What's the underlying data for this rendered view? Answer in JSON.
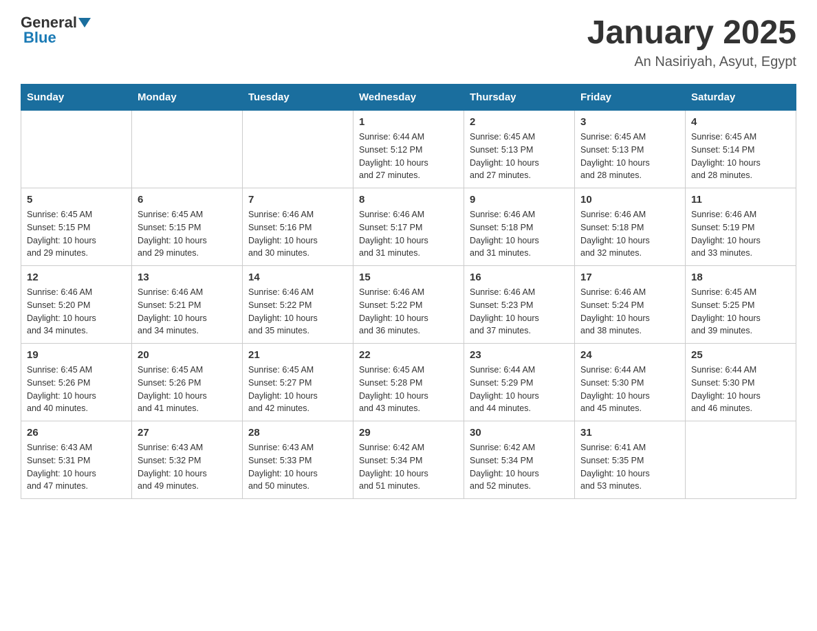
{
  "header": {
    "logo_general": "General",
    "logo_blue": "Blue",
    "title": "January 2025",
    "subtitle": "An Nasiriyah, Asyut, Egypt"
  },
  "calendar": {
    "days_of_week": [
      "Sunday",
      "Monday",
      "Tuesday",
      "Wednesday",
      "Thursday",
      "Friday",
      "Saturday"
    ],
    "weeks": [
      [
        {
          "day": "",
          "info": ""
        },
        {
          "day": "",
          "info": ""
        },
        {
          "day": "",
          "info": ""
        },
        {
          "day": "1",
          "info": "Sunrise: 6:44 AM\nSunset: 5:12 PM\nDaylight: 10 hours\nand 27 minutes."
        },
        {
          "day": "2",
          "info": "Sunrise: 6:45 AM\nSunset: 5:13 PM\nDaylight: 10 hours\nand 27 minutes."
        },
        {
          "day": "3",
          "info": "Sunrise: 6:45 AM\nSunset: 5:13 PM\nDaylight: 10 hours\nand 28 minutes."
        },
        {
          "day": "4",
          "info": "Sunrise: 6:45 AM\nSunset: 5:14 PM\nDaylight: 10 hours\nand 28 minutes."
        }
      ],
      [
        {
          "day": "5",
          "info": "Sunrise: 6:45 AM\nSunset: 5:15 PM\nDaylight: 10 hours\nand 29 minutes."
        },
        {
          "day": "6",
          "info": "Sunrise: 6:45 AM\nSunset: 5:15 PM\nDaylight: 10 hours\nand 29 minutes."
        },
        {
          "day": "7",
          "info": "Sunrise: 6:46 AM\nSunset: 5:16 PM\nDaylight: 10 hours\nand 30 minutes."
        },
        {
          "day": "8",
          "info": "Sunrise: 6:46 AM\nSunset: 5:17 PM\nDaylight: 10 hours\nand 31 minutes."
        },
        {
          "day": "9",
          "info": "Sunrise: 6:46 AM\nSunset: 5:18 PM\nDaylight: 10 hours\nand 31 minutes."
        },
        {
          "day": "10",
          "info": "Sunrise: 6:46 AM\nSunset: 5:18 PM\nDaylight: 10 hours\nand 32 minutes."
        },
        {
          "day": "11",
          "info": "Sunrise: 6:46 AM\nSunset: 5:19 PM\nDaylight: 10 hours\nand 33 minutes."
        }
      ],
      [
        {
          "day": "12",
          "info": "Sunrise: 6:46 AM\nSunset: 5:20 PM\nDaylight: 10 hours\nand 34 minutes."
        },
        {
          "day": "13",
          "info": "Sunrise: 6:46 AM\nSunset: 5:21 PM\nDaylight: 10 hours\nand 34 minutes."
        },
        {
          "day": "14",
          "info": "Sunrise: 6:46 AM\nSunset: 5:22 PM\nDaylight: 10 hours\nand 35 minutes."
        },
        {
          "day": "15",
          "info": "Sunrise: 6:46 AM\nSunset: 5:22 PM\nDaylight: 10 hours\nand 36 minutes."
        },
        {
          "day": "16",
          "info": "Sunrise: 6:46 AM\nSunset: 5:23 PM\nDaylight: 10 hours\nand 37 minutes."
        },
        {
          "day": "17",
          "info": "Sunrise: 6:46 AM\nSunset: 5:24 PM\nDaylight: 10 hours\nand 38 minutes."
        },
        {
          "day": "18",
          "info": "Sunrise: 6:45 AM\nSunset: 5:25 PM\nDaylight: 10 hours\nand 39 minutes."
        }
      ],
      [
        {
          "day": "19",
          "info": "Sunrise: 6:45 AM\nSunset: 5:26 PM\nDaylight: 10 hours\nand 40 minutes."
        },
        {
          "day": "20",
          "info": "Sunrise: 6:45 AM\nSunset: 5:26 PM\nDaylight: 10 hours\nand 41 minutes."
        },
        {
          "day": "21",
          "info": "Sunrise: 6:45 AM\nSunset: 5:27 PM\nDaylight: 10 hours\nand 42 minutes."
        },
        {
          "day": "22",
          "info": "Sunrise: 6:45 AM\nSunset: 5:28 PM\nDaylight: 10 hours\nand 43 minutes."
        },
        {
          "day": "23",
          "info": "Sunrise: 6:44 AM\nSunset: 5:29 PM\nDaylight: 10 hours\nand 44 minutes."
        },
        {
          "day": "24",
          "info": "Sunrise: 6:44 AM\nSunset: 5:30 PM\nDaylight: 10 hours\nand 45 minutes."
        },
        {
          "day": "25",
          "info": "Sunrise: 6:44 AM\nSunset: 5:30 PM\nDaylight: 10 hours\nand 46 minutes."
        }
      ],
      [
        {
          "day": "26",
          "info": "Sunrise: 6:43 AM\nSunset: 5:31 PM\nDaylight: 10 hours\nand 47 minutes."
        },
        {
          "day": "27",
          "info": "Sunrise: 6:43 AM\nSunset: 5:32 PM\nDaylight: 10 hours\nand 49 minutes."
        },
        {
          "day": "28",
          "info": "Sunrise: 6:43 AM\nSunset: 5:33 PM\nDaylight: 10 hours\nand 50 minutes."
        },
        {
          "day": "29",
          "info": "Sunrise: 6:42 AM\nSunset: 5:34 PM\nDaylight: 10 hours\nand 51 minutes."
        },
        {
          "day": "30",
          "info": "Sunrise: 6:42 AM\nSunset: 5:34 PM\nDaylight: 10 hours\nand 52 minutes."
        },
        {
          "day": "31",
          "info": "Sunrise: 6:41 AM\nSunset: 5:35 PM\nDaylight: 10 hours\nand 53 minutes."
        },
        {
          "day": "",
          "info": ""
        }
      ]
    ]
  }
}
